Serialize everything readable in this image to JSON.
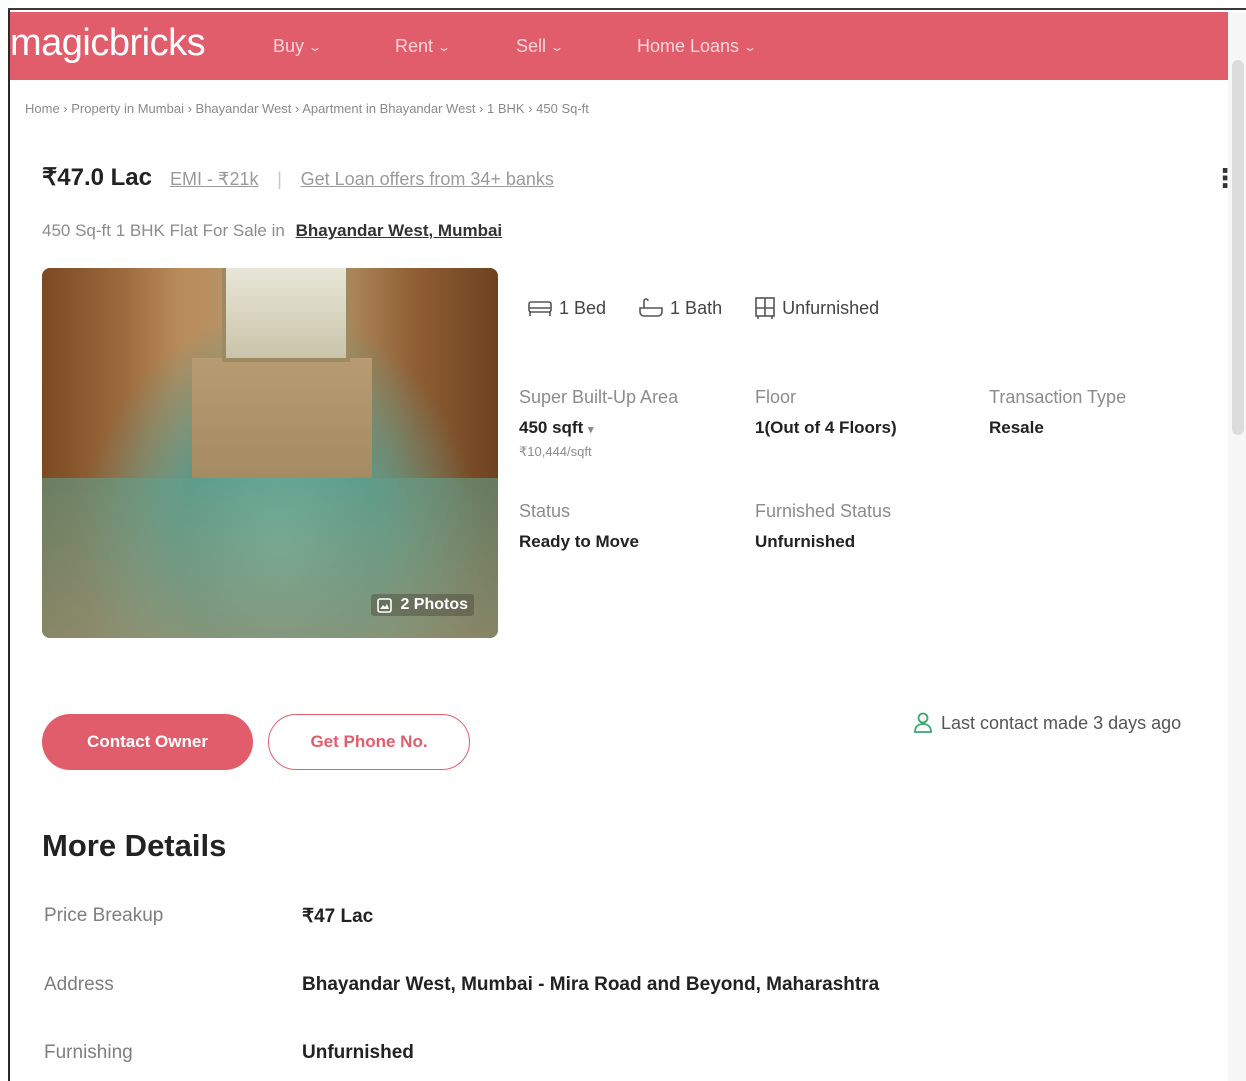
{
  "header": {
    "logo": "magicbricks",
    "brand_color": "#e25d6b",
    "nav": [
      {
        "label": "Buy"
      },
      {
        "label": "Rent"
      },
      {
        "label": "Sell"
      },
      {
        "label": "Home Loans"
      }
    ]
  },
  "breadcrumb": [
    "Home",
    "Property in Mumbai",
    "Bhayandar West",
    "Apartment in Bhayandar West",
    "1 BHK",
    "450 Sq-ft"
  ],
  "listing": {
    "price": "₹47.0 Lac",
    "emi": "EMI - ₹21k",
    "separator": "|",
    "loan_offers": "Get Loan offers from 34+ banks",
    "subtitle_prefix": "450 Sq-ft 1 BHK Flat For Sale in",
    "location": "Bhayandar West, Mumbai",
    "photos_badge": "2 Photos",
    "features": {
      "bed": "1 Bed",
      "bath": "1 Bath",
      "furnishing": "Unfurnished"
    },
    "attributes": {
      "area_label": "Super Built-Up Area",
      "area_value": "450 sqft",
      "area_rate": "₹10,444/sqft",
      "floor_label": "Floor",
      "floor_value": "1(Out of 4 Floors)",
      "transaction_label": "Transaction Type",
      "transaction_value": "Resale",
      "status_label": "Status",
      "status_value": "Ready to Move",
      "furnished_label": "Furnished Status",
      "furnished_value": "Unfurnished"
    },
    "contact_button": "Contact Owner",
    "phone_button": "Get Phone No.",
    "last_contact": "Last contact made 3 days ago"
  },
  "more_details": {
    "title": "More Details",
    "rows": [
      {
        "label": "Price Breakup",
        "value": "₹47 Lac"
      },
      {
        "label": "Address",
        "value": "Bhayandar West, Mumbai - Mira Road and Beyond, Maharashtra"
      },
      {
        "label": "Furnishing",
        "value": "Unfurnished"
      }
    ]
  }
}
